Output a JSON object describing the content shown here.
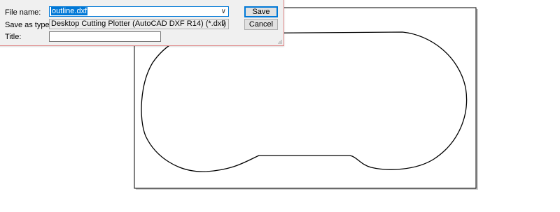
{
  "save_dialog": {
    "file_name_label": "File name:",
    "file_name_value": "outline.dxf",
    "save_as_type_label": "Save as type:",
    "save_as_type_value": "Desktop Cutting Plotter (AutoCAD DXF R14) (*.dxf)",
    "title_label": "Title:",
    "title_value": "",
    "save_button": "Save",
    "cancel_button": "Cancel",
    "dropdown_icon": "chevron-down-icon"
  },
  "colors": {
    "selection": "#0078d7",
    "dialog_background": "#f0f0f0",
    "dialog_border": "#e08a8a",
    "outline_stroke": "#000000"
  }
}
